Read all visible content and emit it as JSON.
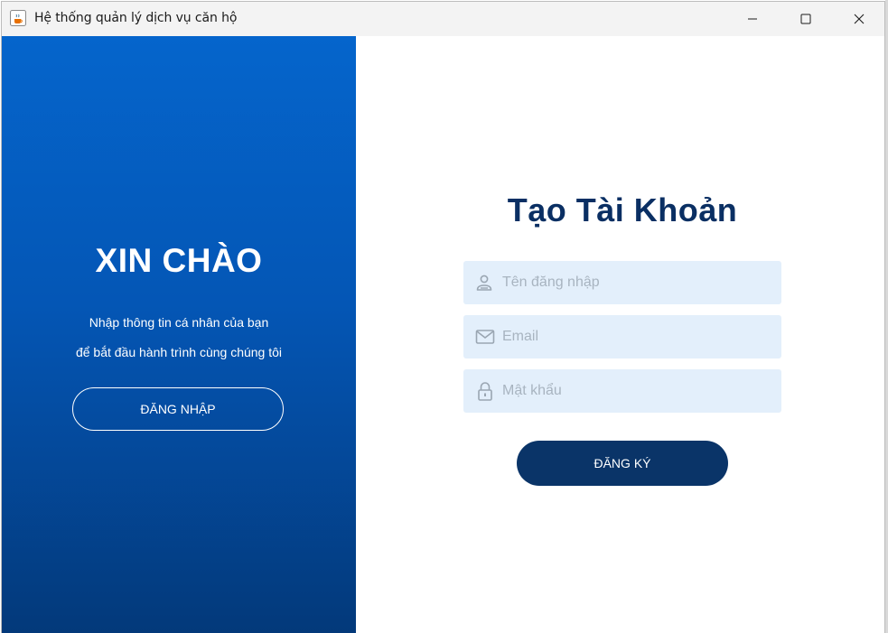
{
  "window": {
    "title": "Hệ thống quản lý dịch vụ căn hộ",
    "app_icon": "java-coffee-icon",
    "controls": [
      "minimize-icon",
      "maximize-icon",
      "close-icon"
    ]
  },
  "left_panel": {
    "heading": "XIN CHÀO",
    "line1": "Nhập thông tin cá nhân của bạn",
    "line2": "để bắt đầu hành trình cùng chúng tôi",
    "login_button": "ĐĂNG NHẬP",
    "gradient_top": "#0565cc",
    "gradient_bottom": "#03397a"
  },
  "form": {
    "title": "Tạo Tài Khoản",
    "username": {
      "placeholder": "Tên đăng nhập",
      "value": "",
      "icon": "user-icon"
    },
    "email": {
      "placeholder": "Email",
      "value": "",
      "icon": "mail-icon"
    },
    "password": {
      "placeholder": "Mật khẩu",
      "value": "",
      "icon": "lock-icon"
    },
    "register_button": "ĐĂNG KÝ",
    "title_color": "#0a2f63",
    "field_bg": "#e3effb",
    "button_color": "#0a3468"
  }
}
